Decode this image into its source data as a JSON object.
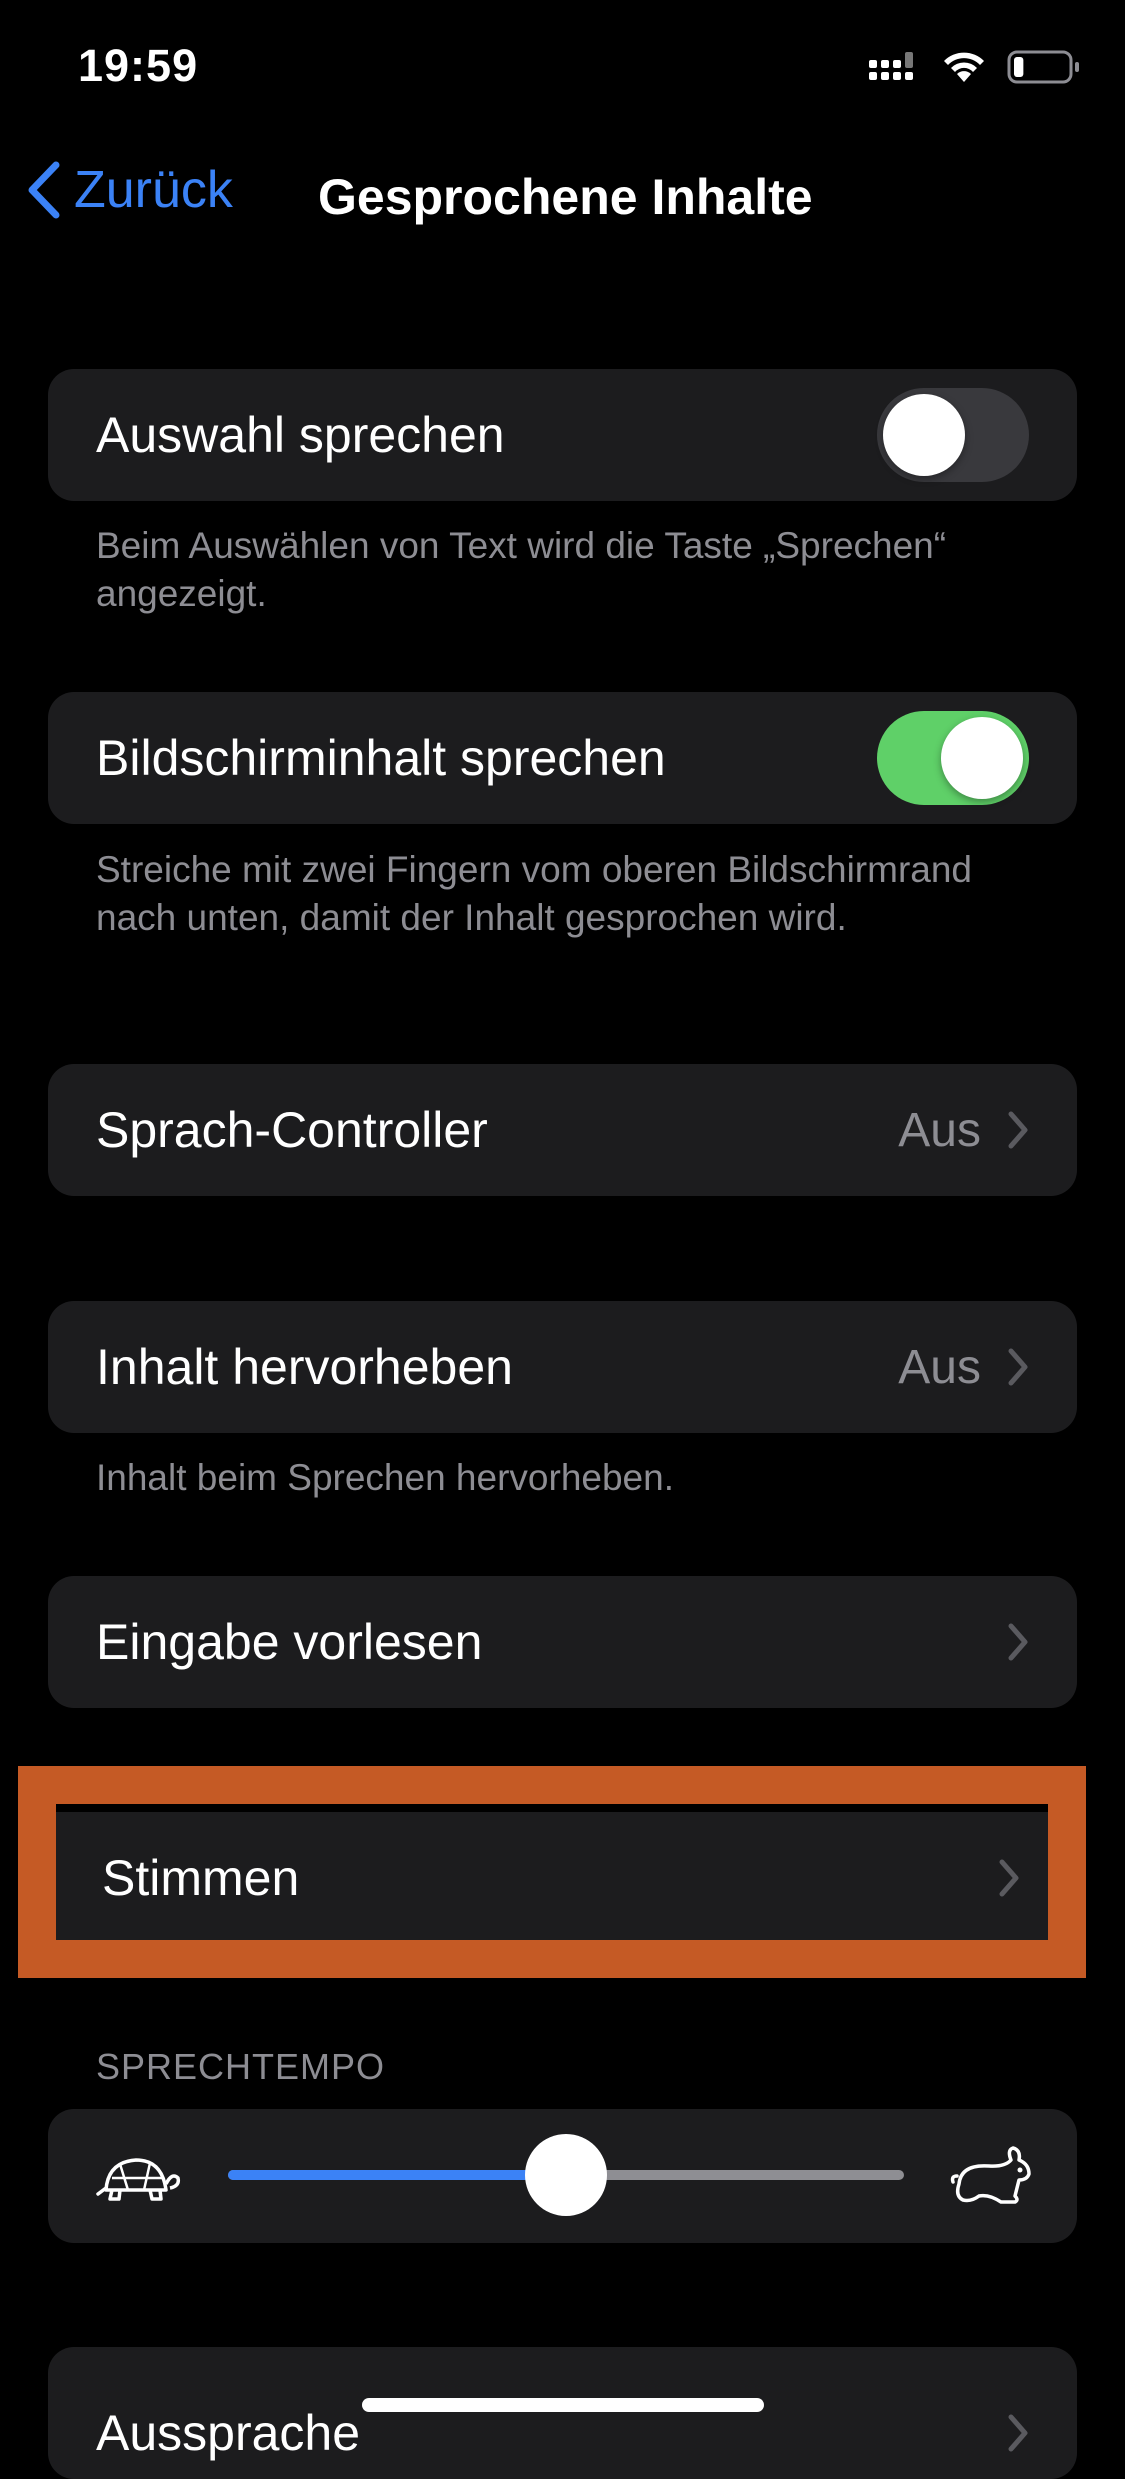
{
  "status_bar": {
    "time": "19:59",
    "battery_level": 0.18
  },
  "nav": {
    "back_label": "Zurück",
    "title": "Gesprochene Inhalte"
  },
  "rows": {
    "speak_selection": {
      "label": "Auswahl sprechen",
      "on": false,
      "footer": "Beim Auswählen von Text wird die Taste „Sprechen“ angezeigt."
    },
    "speak_screen": {
      "label": "Bildschirminhalt sprechen",
      "on": true,
      "footer": "Streiche mit zwei Fingern vom oberen Bildschirmrand nach unten, damit der Inhalt gesprochen wird."
    },
    "speech_controller": {
      "label": "Sprach-Controller",
      "value": "Aus"
    },
    "highlight_content": {
      "label": "Inhalt hervorheben",
      "value": "Aus",
      "footer": "Inhalt beim Sprechen hervorheben."
    },
    "typing_feedback": {
      "label": "Eingabe vorlesen"
    },
    "voices": {
      "label": "Stimmen"
    },
    "pronunciations": {
      "label": "Aussprache"
    }
  },
  "speaking_rate": {
    "header": "SPRECHTEMPO",
    "value": 0.5
  },
  "colors": {
    "accent_blue": "#3b82f6",
    "toggle_on": "#5fd068",
    "toggle_off": "#39393d",
    "highlight_border": "#c55a25",
    "cell_background": "#1c1c1e"
  },
  "icons": {
    "back": "chevron-left-icon",
    "slow": "turtle-icon",
    "fast": "rabbit-icon",
    "disclosure": "chevron-right-icon"
  }
}
